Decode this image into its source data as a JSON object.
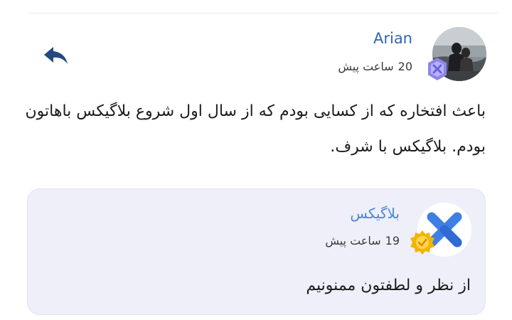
{
  "comment": {
    "author": "Arian",
    "time_value": "20",
    "time_unit": "ساعت پیش",
    "text": "باعث افتخاره که از کسایی بودم که از سال اول شروع بلاگیکس باهاتون بودم. بلاگیکس با شرف.",
    "avatar_icon": "user-photo",
    "badge_icon": "level-badge-icon",
    "reply_icon": "reply-arrow-icon"
  },
  "reply": {
    "author": "بلاگیکس",
    "time_value": "19",
    "time_unit": "ساعت پیش",
    "text": "از نظر و لطفتون ممنونیم",
    "avatar_icon": "blogix-logo-icon",
    "badge_icon": "gold-badge-icon"
  },
  "colors": {
    "author_blue": "#2f66b3",
    "reply_author_blue": "#4a86d8",
    "card_bg": "#eeeff8",
    "logo_blue": "#3f7fe3"
  }
}
